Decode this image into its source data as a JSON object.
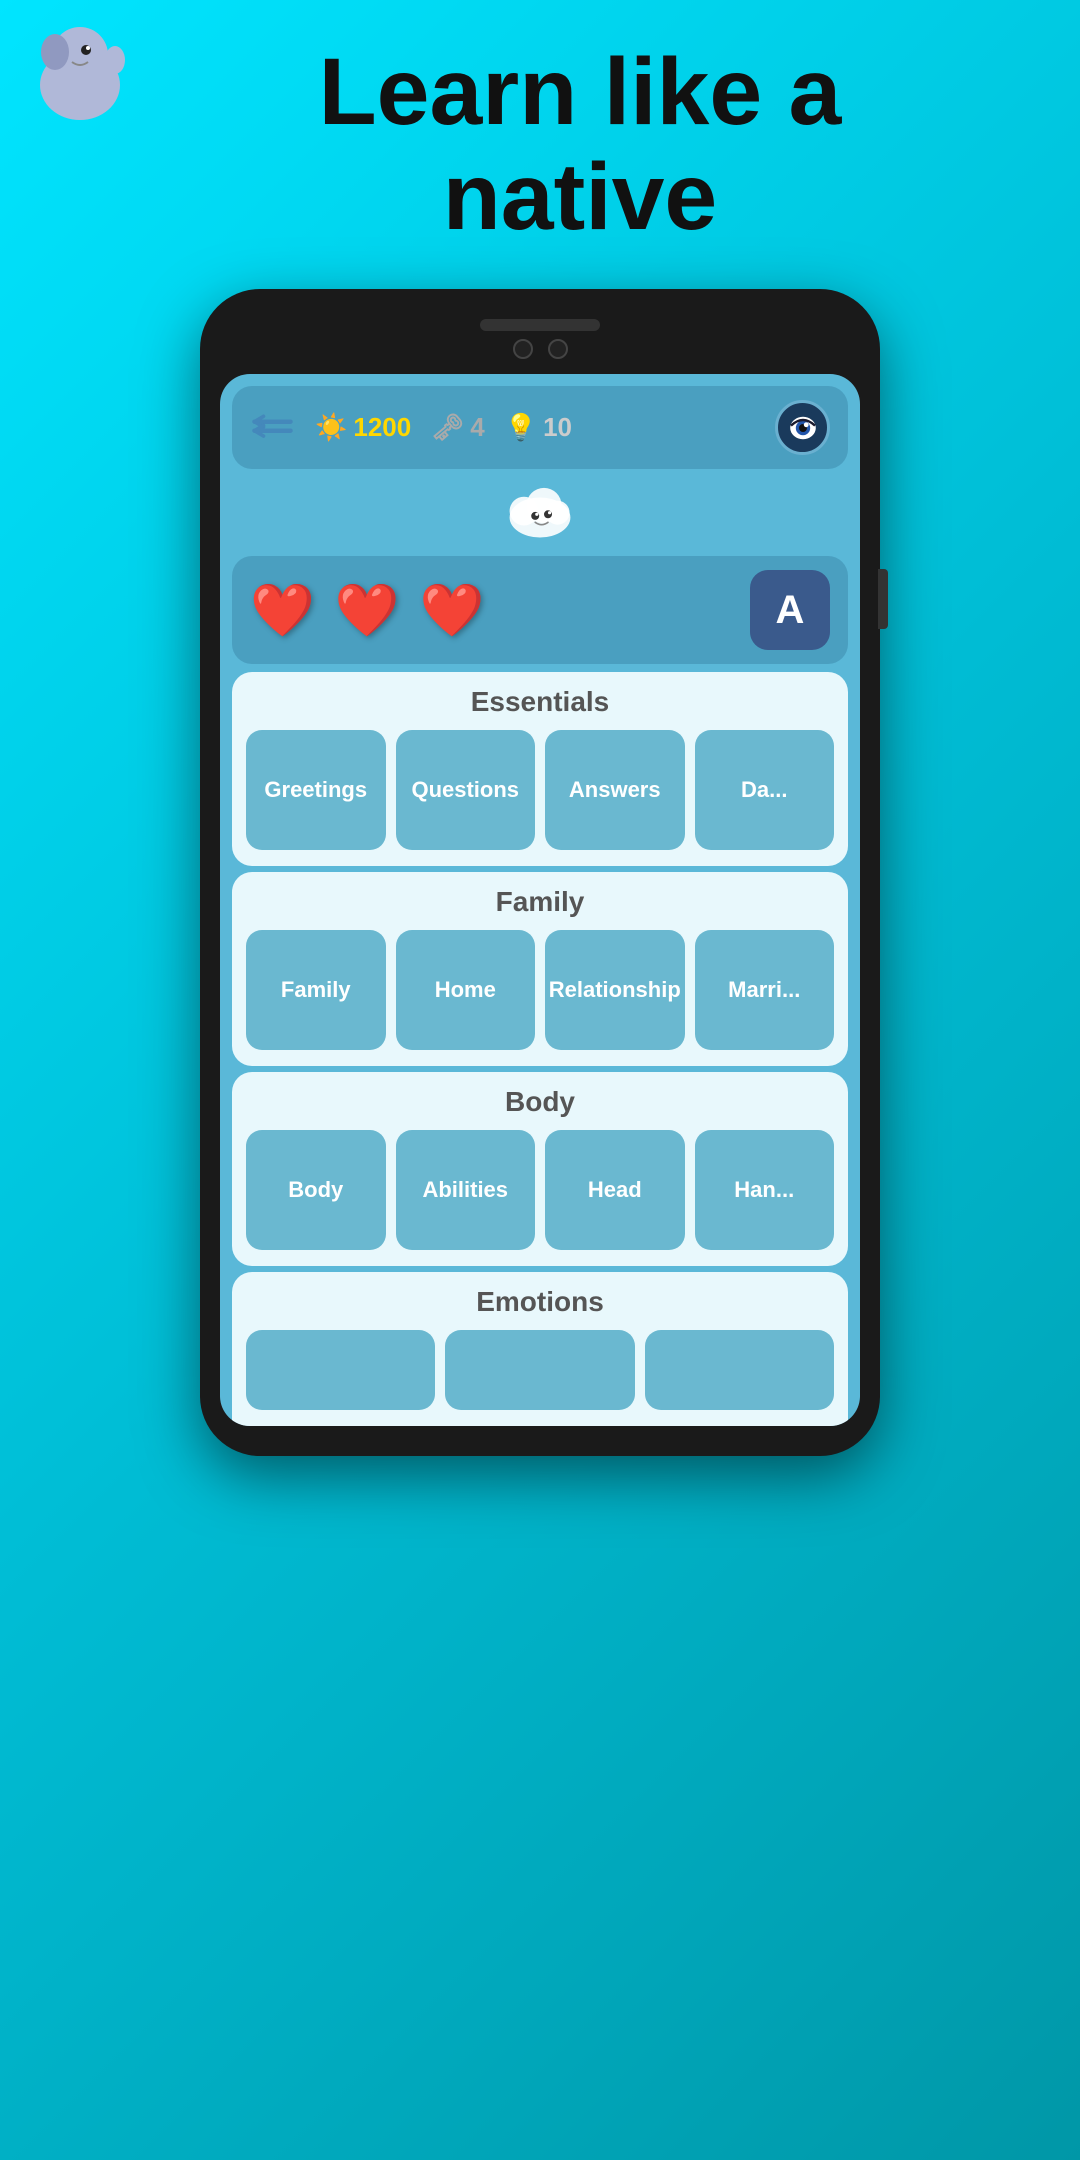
{
  "app": {
    "headline_line1": "Learn like a",
    "headline_line2": "native"
  },
  "stats": {
    "xp_icon": "☀",
    "xp_value": "1200",
    "keys_icon": "🗝",
    "keys_value": "4",
    "bulb_icon": "💡",
    "bulb_value": "10"
  },
  "lives": {
    "hearts": [
      "❤",
      "❤",
      "❤"
    ],
    "letter": "A"
  },
  "sections": [
    {
      "id": "essentials",
      "title": "Essentials",
      "cards": [
        {
          "label": "Greetings"
        },
        {
          "label": "Questions"
        },
        {
          "label": "Answers"
        },
        {
          "label": "Da..."
        }
      ]
    },
    {
      "id": "family",
      "title": "Family",
      "cards": [
        {
          "label": "Family"
        },
        {
          "label": "Home"
        },
        {
          "label": "Relationship"
        },
        {
          "label": "Marri..."
        }
      ]
    },
    {
      "id": "body",
      "title": "Body",
      "cards": [
        {
          "label": "Body"
        },
        {
          "label": "Abilities"
        },
        {
          "label": "Head"
        },
        {
          "label": "Han..."
        }
      ]
    },
    {
      "id": "emotions",
      "title": "Emotions",
      "cards": [
        {
          "label": ""
        },
        {
          "label": ""
        },
        {
          "label": ""
        }
      ]
    }
  ],
  "back_button_label": "←",
  "mascot_alt": "cloud mascot",
  "profile_icon": "👁"
}
